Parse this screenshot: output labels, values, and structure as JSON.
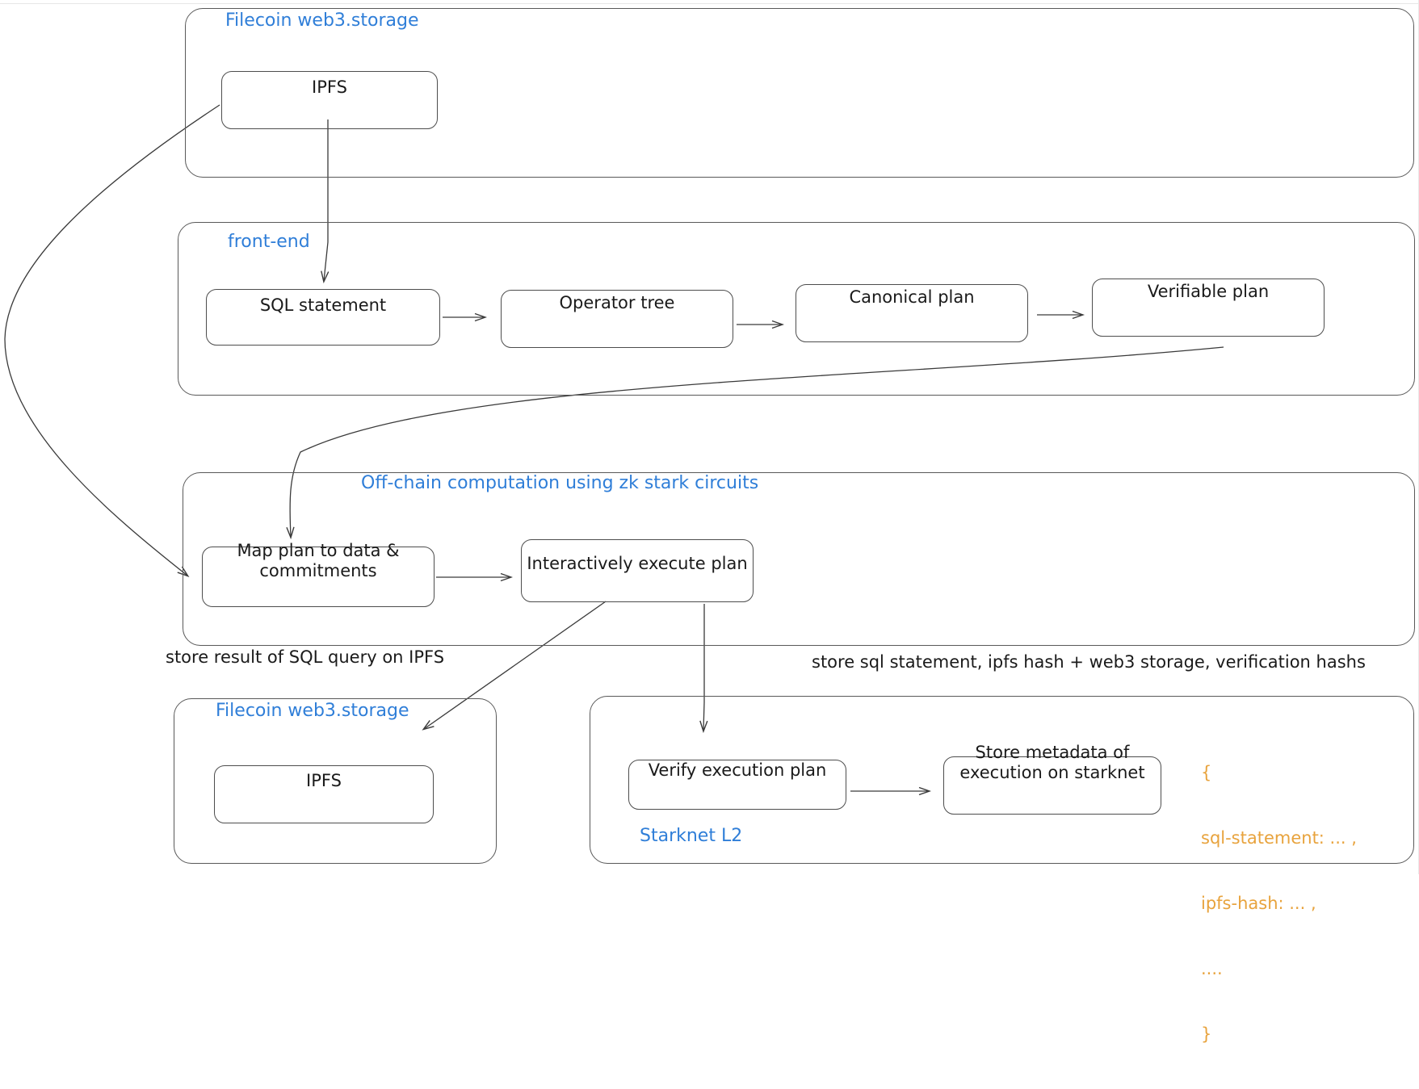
{
  "diagram": {
    "title_hidden": "",
    "groups": [
      {
        "id": "filecoin_top",
        "label": "Filecoin web3.storage"
      },
      {
        "id": "frontend",
        "label": "front-end"
      },
      {
        "id": "offchain",
        "label": "Off-chain computation using zk stark circuits"
      },
      {
        "id": "filecoin_bot",
        "label": "Filecoin web3.storage"
      },
      {
        "id": "starknet",
        "label": "Starknet L2"
      }
    ],
    "nodes": [
      {
        "id": "ipfs_top",
        "label": "IPFS"
      },
      {
        "id": "sql_statement",
        "label": "SQL statement"
      },
      {
        "id": "operator_tree",
        "label": "Operator tree"
      },
      {
        "id": "canonical_plan",
        "label": "Canonical plan"
      },
      {
        "id": "verifiable_plan",
        "label": "Verifiable plan"
      },
      {
        "id": "map_plan",
        "label": "Map plan to data &\ncommitments"
      },
      {
        "id": "exec_plan",
        "label": "Interactively execute plan"
      },
      {
        "id": "ipfs_bottom",
        "label": "IPFS"
      },
      {
        "id": "verify_plan",
        "label": "Verify execution plan"
      },
      {
        "id": "store_meta",
        "label": "Store metadata of\nexecution on starknet"
      }
    ],
    "captions": [
      {
        "id": "caption_ipfs_result",
        "text": "store result of SQL query on IPFS"
      },
      {
        "id": "caption_starknet",
        "text": "store sql statement, ipfs hash + web3 storage, verification hashs"
      }
    ],
    "json_snippet": {
      "line1": "{",
      "line2": "sql-statement: ... ,",
      "line3": "ipfs-hash: ... ,",
      "line4": "....",
      "line5": "}"
    },
    "colors": {
      "group_title": "#2f7ed8",
      "json_text": "#e8a33d",
      "stroke": "#4d4d4d",
      "text": "#1a1a1a",
      "background": "#ffffff"
    }
  }
}
